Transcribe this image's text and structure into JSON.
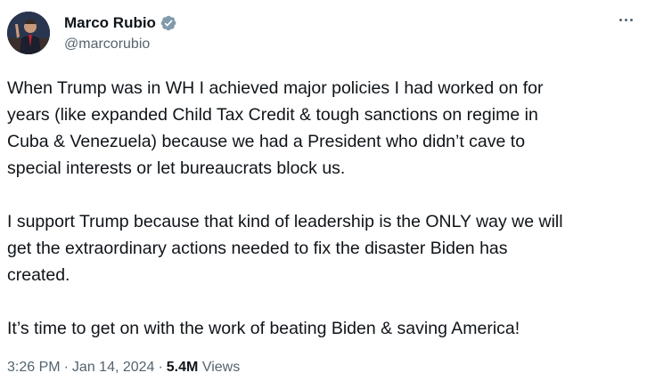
{
  "author": {
    "display_name": "Marco Rubio",
    "handle": "@marcorubio",
    "verified": true,
    "verified_badge_color": "#829aab"
  },
  "tweet": {
    "paragraphs": [
      "When Trump was in WH I achieved major policies I had worked on for\nyears (like expanded Child Tax Credit & tough sanctions on regime in\nCuba & Venezuela) because we had a President who didn’t cave to\nspecial interests or let bureaucrats block us.",
      "I support Trump because that kind of leadership is the ONLY way we will\nget the extraordinary actions needed to fix the disaster Biden has\ncreated.",
      "It’s time to get on with the work of beating Biden & saving America!"
    ]
  },
  "meta": {
    "time": "3:26 PM",
    "separator": "·",
    "date": "Jan 14, 2024",
    "views_count": "5.4M",
    "views_label": "Views"
  },
  "icons": {
    "more": "more-horizontal-icon",
    "verified": "verified-badge-icon"
  }
}
